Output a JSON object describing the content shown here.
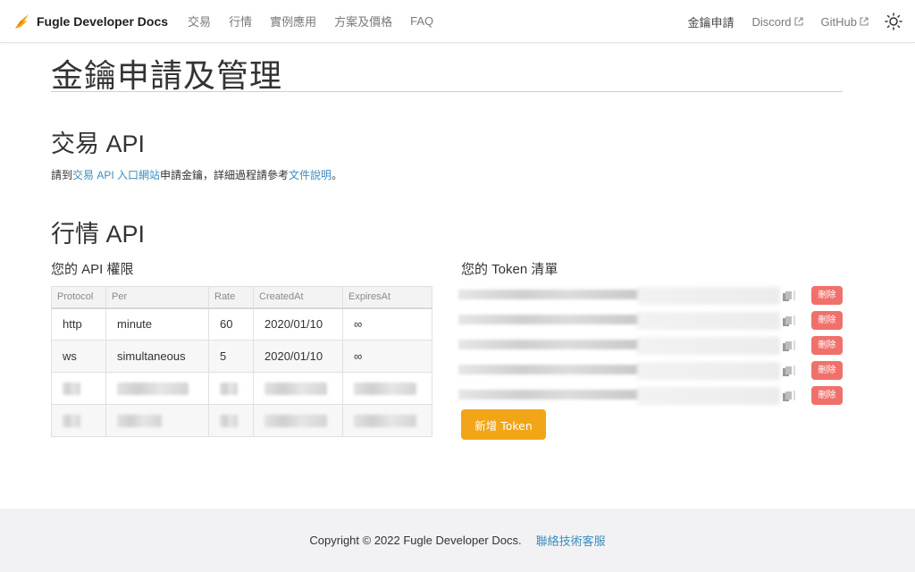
{
  "navbar": {
    "brand_title": "Fugle Developer Docs",
    "left_links": [
      "交易",
      "行情",
      "實例應用",
      "方案及價格",
      "FAQ"
    ],
    "right_active": "金鑰申請",
    "discord": "Discord",
    "github": "GitHub",
    "accent_color": "#f2a516"
  },
  "page": {
    "title": "金鑰申請及管理"
  },
  "trading": {
    "heading": "交易 API",
    "text_pre": "請到",
    "link1": "交易 API 入口網站",
    "text_mid": "申請金鑰，詳細過程請參考",
    "link2": "文件說明",
    "text_post": "。"
  },
  "market": {
    "heading": "行情 API",
    "permissions_heading": "您的 API 權限",
    "tokens_heading": "您的 Token 清單",
    "table": {
      "headers": [
        "Protocol",
        "Per",
        "Rate",
        "CreatedAt",
        "ExpiresAt"
      ],
      "rows": [
        [
          "http",
          "minute",
          "60",
          "2020/01/10",
          "∞"
        ],
        [
          "ws",
          "simultaneous",
          "5",
          "2020/01/10",
          "∞"
        ]
      ]
    },
    "delete_label": "刪除",
    "add_token_label": "新增 Token"
  },
  "footer": {
    "copyright": "Copyright © 2022 Fugle Developer Docs.",
    "support_link": "聯絡技術客服"
  }
}
